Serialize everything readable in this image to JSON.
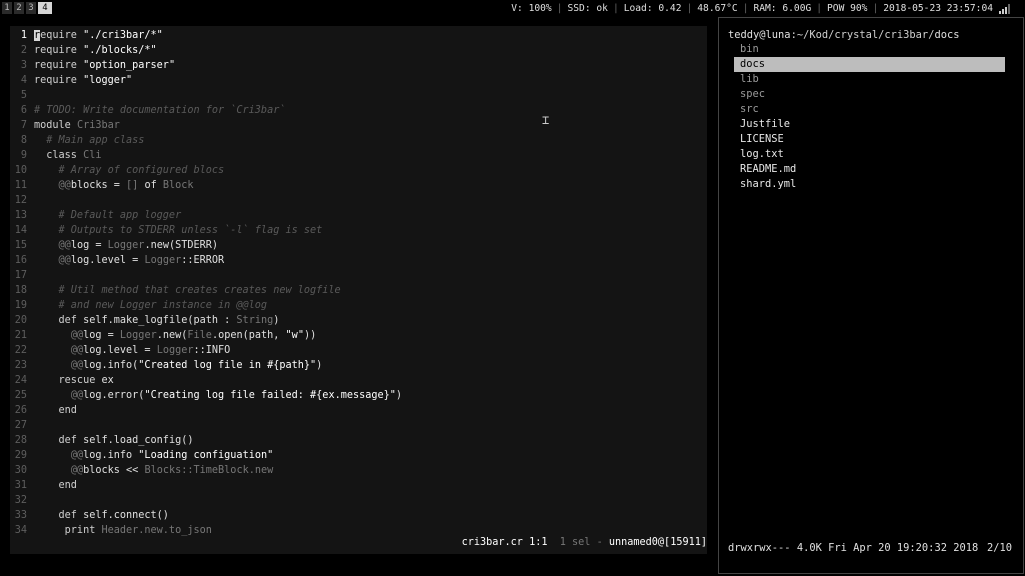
{
  "topbar": {
    "workspaces": [
      "1",
      "2",
      "3",
      "4"
    ],
    "active_workspace": "4",
    "status": {
      "volume": "V: 100%",
      "ssd": "SSD: ok",
      "load": "Load: 0.42",
      "temp": "48.67°C",
      "ram": "RAM: 6.00G",
      "power": "POW 90%",
      "datetime": "2018-05-23 23:57:04"
    },
    "wifi_icon": "wifi-signal-icon"
  },
  "editor": {
    "lines": [
      {
        "n": "1",
        "segs": [
          {
            "t": "r",
            "c": "cursor"
          },
          {
            "t": "equire ",
            "c": "k"
          },
          {
            "t": "\"./cri3bar/*\"",
            "c": "s"
          }
        ]
      },
      {
        "n": "2",
        "segs": [
          {
            "t": "require ",
            "c": "k"
          },
          {
            "t": "\"./blocks/*\"",
            "c": "s"
          }
        ]
      },
      {
        "n": "3",
        "segs": [
          {
            "t": "require ",
            "c": "k"
          },
          {
            "t": "\"option_parser\"",
            "c": "s"
          }
        ]
      },
      {
        "n": "4",
        "segs": [
          {
            "t": "require ",
            "c": "k"
          },
          {
            "t": "\"logger\"",
            "c": "s"
          }
        ]
      },
      {
        "n": "5",
        "segs": []
      },
      {
        "n": "6",
        "segs": [
          {
            "t": "# TODO: Write documentation for `Cri3bar`",
            "c": "c"
          }
        ]
      },
      {
        "n": "7",
        "segs": [
          {
            "t": "module ",
            "c": "k"
          },
          {
            "t": "Cri3bar",
            "c": "t"
          }
        ]
      },
      {
        "n": "8",
        "segs": [
          {
            "t": "  # Main app class",
            "c": "c"
          }
        ]
      },
      {
        "n": "9",
        "segs": [
          {
            "t": "  class ",
            "c": "k"
          },
          {
            "t": "Cli",
            "c": "t"
          }
        ]
      },
      {
        "n": "10",
        "segs": [
          {
            "t": "    # Array of configured blocs",
            "c": "c"
          }
        ]
      },
      {
        "n": "11",
        "segs": [
          {
            "t": "    ",
            "c": "k"
          },
          {
            "t": "@@",
            "c": "t"
          },
          {
            "t": "blocks = ",
            "c": "i"
          },
          {
            "t": "[]",
            "c": "t"
          },
          {
            "t": " of ",
            "c": "i"
          },
          {
            "t": "Block",
            "c": "t"
          }
        ]
      },
      {
        "n": "12",
        "segs": []
      },
      {
        "n": "13",
        "segs": [
          {
            "t": "    # Default app logger",
            "c": "c"
          }
        ]
      },
      {
        "n": "14",
        "segs": [
          {
            "t": "    # Outputs to STDERR unless `-l` flag is set",
            "c": "c"
          }
        ]
      },
      {
        "n": "15",
        "segs": [
          {
            "t": "    ",
            "c": "k"
          },
          {
            "t": "@@",
            "c": "t"
          },
          {
            "t": "log = ",
            "c": "i"
          },
          {
            "t": "Logger",
            "c": "t"
          },
          {
            "t": ".new(STDERR)",
            "c": "i"
          }
        ]
      },
      {
        "n": "16",
        "segs": [
          {
            "t": "    ",
            "c": "k"
          },
          {
            "t": "@@",
            "c": "t"
          },
          {
            "t": "log.level = ",
            "c": "i"
          },
          {
            "t": "Logger",
            "c": "t"
          },
          {
            "t": "::ERROR",
            "c": "i"
          }
        ]
      },
      {
        "n": "17",
        "segs": []
      },
      {
        "n": "18",
        "segs": [
          {
            "t": "    # Util method that creates creates new logfile",
            "c": "c"
          }
        ]
      },
      {
        "n": "19",
        "segs": [
          {
            "t": "    # and new Logger instance in @@log",
            "c": "c"
          }
        ]
      },
      {
        "n": "20",
        "segs": [
          {
            "t": "    def ",
            "c": "k"
          },
          {
            "t": "self.make_logfile(path : ",
            "c": "i"
          },
          {
            "t": "String",
            "c": "t"
          },
          {
            "t": ")",
            "c": "i"
          }
        ]
      },
      {
        "n": "21",
        "segs": [
          {
            "t": "      ",
            "c": "k"
          },
          {
            "t": "@@",
            "c": "t"
          },
          {
            "t": "log = ",
            "c": "i"
          },
          {
            "t": "Logger",
            "c": "t"
          },
          {
            "t": ".new(",
            "c": "i"
          },
          {
            "t": "File",
            "c": "t"
          },
          {
            "t": ".open(path, ",
            "c": "i"
          },
          {
            "t": "\"w\"",
            "c": "s"
          },
          {
            "t": "))",
            "c": "i"
          }
        ]
      },
      {
        "n": "22",
        "segs": [
          {
            "t": "      ",
            "c": "k"
          },
          {
            "t": "@@",
            "c": "t"
          },
          {
            "t": "log.level = ",
            "c": "i"
          },
          {
            "t": "Logger",
            "c": "t"
          },
          {
            "t": "::INFO",
            "c": "i"
          }
        ]
      },
      {
        "n": "23",
        "segs": [
          {
            "t": "      ",
            "c": "k"
          },
          {
            "t": "@@",
            "c": "t"
          },
          {
            "t": "log.info(",
            "c": "i"
          },
          {
            "t": "\"Created log file in #{path}\"",
            "c": "s"
          },
          {
            "t": ")",
            "c": "i"
          }
        ]
      },
      {
        "n": "24",
        "segs": [
          {
            "t": "    rescue ",
            "c": "k"
          },
          {
            "t": "ex",
            "c": "i"
          }
        ]
      },
      {
        "n": "25",
        "segs": [
          {
            "t": "      ",
            "c": "k"
          },
          {
            "t": "@@",
            "c": "t"
          },
          {
            "t": "log.error(",
            "c": "i"
          },
          {
            "t": "\"Creating log file failed: #{ex.message}\"",
            "c": "s"
          },
          {
            "t": ")",
            "c": "i"
          }
        ]
      },
      {
        "n": "26",
        "segs": [
          {
            "t": "    end",
            "c": "k"
          }
        ]
      },
      {
        "n": "27",
        "segs": []
      },
      {
        "n": "28",
        "segs": [
          {
            "t": "    def ",
            "c": "k"
          },
          {
            "t": "self.load_config()",
            "c": "i"
          }
        ]
      },
      {
        "n": "29",
        "segs": [
          {
            "t": "      ",
            "c": "k"
          },
          {
            "t": "@@",
            "c": "t"
          },
          {
            "t": "log.info ",
            "c": "i"
          },
          {
            "t": "\"Loading configuation\"",
            "c": "s"
          }
        ]
      },
      {
        "n": "30",
        "segs": [
          {
            "t": "      ",
            "c": "k"
          },
          {
            "t": "@@",
            "c": "t"
          },
          {
            "t": "blocks << ",
            "c": "i"
          },
          {
            "t": "Blocks::TimeBlock.new",
            "c": "t"
          }
        ]
      },
      {
        "n": "31",
        "segs": [
          {
            "t": "    end",
            "c": "k"
          }
        ]
      },
      {
        "n": "32",
        "segs": []
      },
      {
        "n": "33",
        "segs": [
          {
            "t": "    def ",
            "c": "k"
          },
          {
            "t": "self.connect()",
            "c": "i"
          }
        ]
      },
      {
        "n": "34",
        "segs": [
          {
            "t": "     print ",
            "c": "k"
          },
          {
            "t": "Header.new.to_json",
            "c": "t"
          }
        ]
      }
    ],
    "status": {
      "file": "cri3bar.cr",
      "position": "1:1",
      "sel": "1 sel",
      "dash": "-",
      "client": "unnamed0@[15911]"
    }
  },
  "file_manager": {
    "path_user": "teddy@luna",
    "path_dir": ":~/Kod/crystal/cri3bar/",
    "path_current": "docs",
    "items": [
      {
        "name": "bin",
        "type": "dir"
      },
      {
        "name": "docs",
        "type": "dir",
        "selected": true
      },
      {
        "name": "lib",
        "type": "dir"
      },
      {
        "name": "spec",
        "type": "dir"
      },
      {
        "name": "src",
        "type": "dir"
      },
      {
        "name": "Justfile",
        "type": "file"
      },
      {
        "name": "LICENSE",
        "type": "file"
      },
      {
        "name": "log.txt",
        "type": "file"
      },
      {
        "name": "README.md",
        "type": "file"
      },
      {
        "name": "shard.yml",
        "type": "file"
      }
    ],
    "status_info": "drwxrwx--- 4.0K Fri Apr 20 19:20:32 2018",
    "status_pos": "2/10"
  }
}
